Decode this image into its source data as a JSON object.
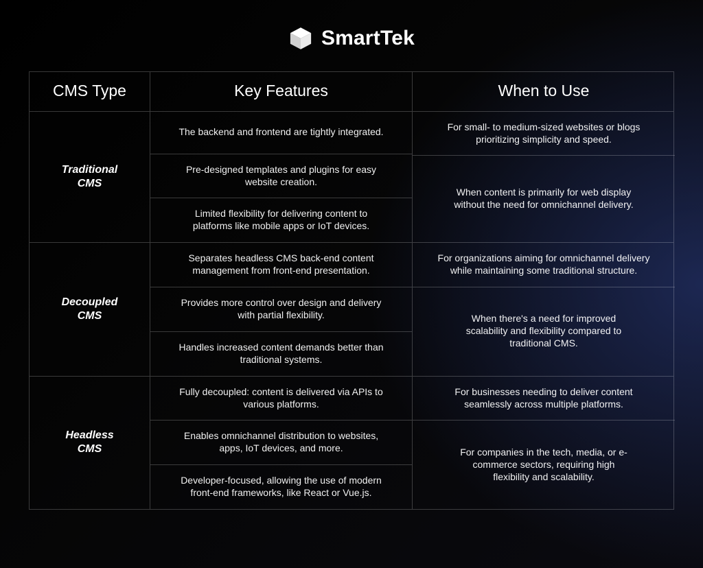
{
  "brand": {
    "name": "SmartTek"
  },
  "table": {
    "headers": {
      "type": "CMS Type",
      "features": "Key Features",
      "when": "When to Use"
    },
    "rows": [
      {
        "label": "Traditional\nCMS",
        "features": [
          "The backend and frontend are tightly integrated.",
          "Pre-designed templates and plugins for easy website creation.",
          "Limited flexibility for delivering content to platforms like mobile apps or IoT devices."
        ],
        "use_top": "For small- to medium-sized websites or blogs prioritizing simplicity and speed.",
        "use_span": "When content is primarily for web display without the need for omnichannel delivery."
      },
      {
        "label": "Decoupled\nCMS",
        "features": [
          "Separates headless CMS back-end content management from front-end presentation.",
          "Provides more control over design and delivery with partial flexibility.",
          "Handles increased content demands better than traditional systems."
        ],
        "use_top": "For organizations aiming for omnichannel delivery while maintaining some traditional structure.",
        "use_span": "When there's a need for improved scalability and flexibility compared to traditional CMS."
      },
      {
        "label": "Headless\nCMS",
        "features": [
          "Fully decoupled: content is delivered via APIs to various platforms.",
          "Enables omnichannel distribution to websites, apps, IoT devices, and more.",
          "Developer-focused, allowing the use of modern front-end frameworks, like React or Vue.js."
        ],
        "use_top": "For businesses needing to deliver content seamlessly across multiple platforms.",
        "use_span": "For companies in the tech, media, or e-commerce sectors, requiring high flexibility and scalability."
      }
    ]
  }
}
